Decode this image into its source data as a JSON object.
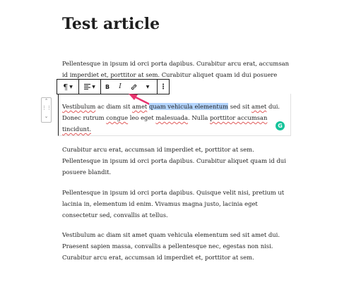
{
  "article": {
    "title": "Test article"
  },
  "toolbar": {
    "paragraph_icon": "paragraph-icon",
    "align_icon": "align-left-icon",
    "bold_label": "B",
    "italic_label": "I",
    "link_icon": "link-icon",
    "more_icon": "more-vertical-icon"
  },
  "paragraphs": {
    "p1": [
      "Pellentesque in ipsum id orci porta dapibus. Curabitur arcu erat, accumsan",
      "id imperdiet et, porttitor at sem. Curabitur aliquet quam id dui posuere"
    ],
    "selected": {
      "line1_a": "Vestibulum",
      "line1_b": " ac diam sit ",
      "line1_c": "amet",
      "line1_d": " ",
      "line1_sel": "quam vehicula elementum",
      "line1_e": " sed sit ",
      "line1_f": "amet",
      "line1_g": " dui.",
      "line2_a": "Donec rutrum ",
      "line2_b": "congue",
      "line2_c": " leo eget ",
      "line2_d": "malesuada",
      "line2_e": ". Nulla ",
      "line2_f": "porttitor accumsan",
      "line3": "tincidunt."
    },
    "p3": [
      "Curabitur arcu erat, accumsan id imperdiet et, porttitor at sem.",
      "Pellentesque in ipsum id orci porta dapibus. Curabitur aliquet quam id dui",
      "posuere blandit."
    ],
    "p4": [
      "Pellentesque in ipsum id orci porta dapibus. Quisque velit nisi, pretium ut",
      "lacinia in, elementum id enim. Vivamus magna justo, lacinia eget",
      "consectetur sed, convallis at tellus."
    ],
    "p5": [
      "Vestibulum ac diam sit amet quam vehicula elementum sed sit amet dui.",
      "Praesent sapien massa, convallis a pellentesque nec, egestas non nisi.",
      "Curabitur arcu erat, accumsan id imperdiet et, porttitor at sem."
    ]
  },
  "grammarly": {
    "label": "G"
  },
  "colors": {
    "selection": "#b4d5fe",
    "arrow": "#e8336e",
    "grammarly": "#15c39a"
  }
}
